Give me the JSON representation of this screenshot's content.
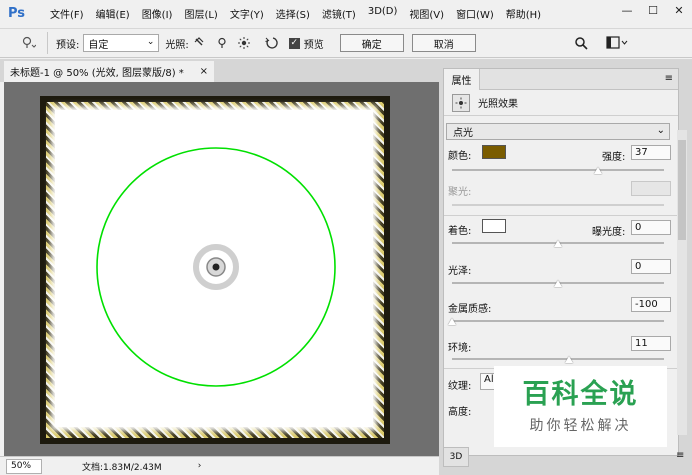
{
  "app": {
    "logo": "Ps",
    "menu": [
      "文件(F)",
      "编辑(E)",
      "图像(I)",
      "图层(L)",
      "文字(Y)",
      "选择(S)",
      "滤镜(T)",
      "3D(D)",
      "视图(V)",
      "窗口(W)",
      "帮助(H)"
    ],
    "window_controls": [
      "—",
      "☐",
      "✕"
    ]
  },
  "options_bar": {
    "preset_label": "预设:",
    "preset_value": "自定",
    "lights_label": "光照:",
    "preview_label": "预览",
    "ok_label": "确定",
    "cancel_label": "取消"
  },
  "document": {
    "tab_title": "未标题-1 @ 50% (光效, 图层蒙版/8) *",
    "close": "×",
    "zoom": "50%",
    "doc_info": "文档:1.83M/2.43M",
    "status_arrow": "›"
  },
  "properties": {
    "tab_label": "属性",
    "panel_menu": "≡",
    "header_title": "光照效果",
    "light_type": "点光",
    "color_label": "颜色:",
    "color_swatch": "#7a5c00",
    "intensity_label": "强度:",
    "intensity_value": "37",
    "hotspot_label": "聚光:",
    "tint_label": "着色:",
    "tint_swatch": "#ffffff",
    "exposure_label": "曝光度:",
    "exposure_value": "0",
    "gloss_label": "光泽:",
    "gloss_value": "0",
    "metallic_label": "金属质感:",
    "metallic_value": "-100",
    "ambience_label": "环境:",
    "ambience_value": "11",
    "texture_label": "纹理:",
    "texture_value": "Al",
    "height_label": "高度:",
    "bottom_tab": "3D",
    "bottom_menu": "≡",
    "sliders": {
      "intensity": 0.69,
      "hotspot": 0.0,
      "exposure": 0.5,
      "gloss": 0.5,
      "metallic": 0.0,
      "ambience": 0.55
    }
  },
  "watermark": {
    "main": "百科全说",
    "sub": "助你轻松解决"
  },
  "canvas": {
    "ring_color": "#00e000"
  }
}
